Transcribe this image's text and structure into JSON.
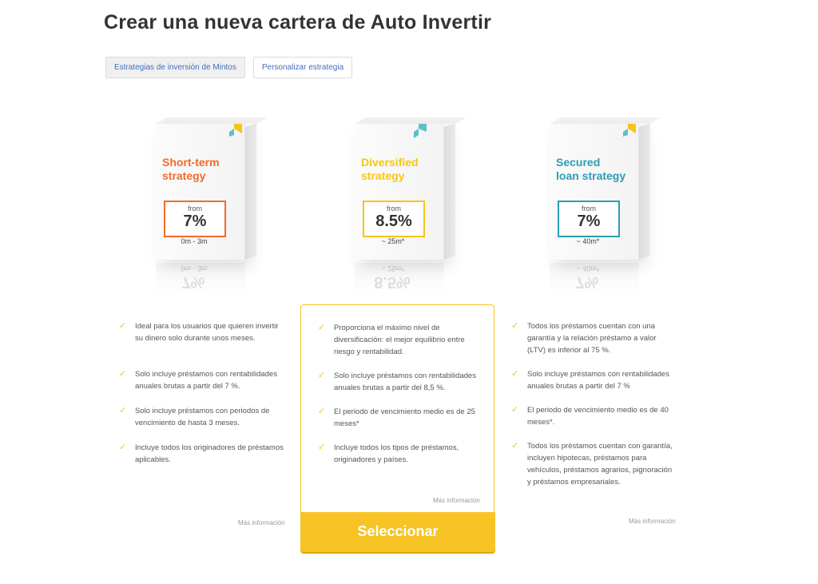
{
  "header": {
    "title": "Crear una nueva cartera de Auto Invertir"
  },
  "tabs": [
    {
      "label": "Estrategias de inversión de Mintos"
    },
    {
      "label": "Personalizar estrategia"
    }
  ],
  "strategies": [
    {
      "title_line1": "Short-term",
      "title_line2": "strategy",
      "accent": "#f26b2a",
      "from_label": "from",
      "rate": "7%",
      "term": "0m - 3m",
      "reflection_term": "0m - 3m",
      "features": [
        "Ideal para los usuarios que quieren invertir su dinero solo durante unos meses.",
        "Solo incluye préstamos con rentabilidades anuales brutas a partir del 7 %.",
        "Solo incluye préstamos con periodos de vencimiento de hasta 3 meses.",
        "Incluye todos los originadores de préstamos aplicables."
      ],
      "more": "Más información"
    },
    {
      "title_line1": "Diversified",
      "title_line2": "strategy",
      "accent": "#f5c518",
      "from_label": "from",
      "rate": "8.5%",
      "term": "~ 25m*",
      "reflection_term": "~ 25m*",
      "features": [
        "Proporciona el máximo nivel de diversificación: el mejor equilibrio entre riesgo y rentabilidad.",
        "Solo incluye préstamos con rentabilidades anuales brutas a partir del 8,5 %.",
        "El periodo de vencimiento medio es de 25 meses*",
        "Incluye todos los tipos de préstamos, originadores y países."
      ],
      "more": "Más información"
    },
    {
      "title_line1": "Secured",
      "title_line2": "loan strategy",
      "accent": "#2a9db5",
      "from_label": "from",
      "rate": "7%",
      "term": "~ 40m*",
      "reflection_term": "~ 40m*",
      "features": [
        "Todos los préstamos cuentan con una garantía y la relación préstamo a valor (LTV) es inferior al 75 %.",
        "Solo incluye préstamos con rentabilidades anuales brutas a partir del 7 %",
        "El periodo de vencimiento medio es de 40 meses*.",
        "Todos los préstamos cuentan con garantía, incluyen hipotecas, préstamos para vehículos, préstamos agrarios, pignoración y préstamos empresariales."
      ],
      "more": "Más información"
    }
  ],
  "select_button": "Seleccionar",
  "colors": {
    "yellow": "#f5c518",
    "link_blue": "#3f6fc0"
  }
}
